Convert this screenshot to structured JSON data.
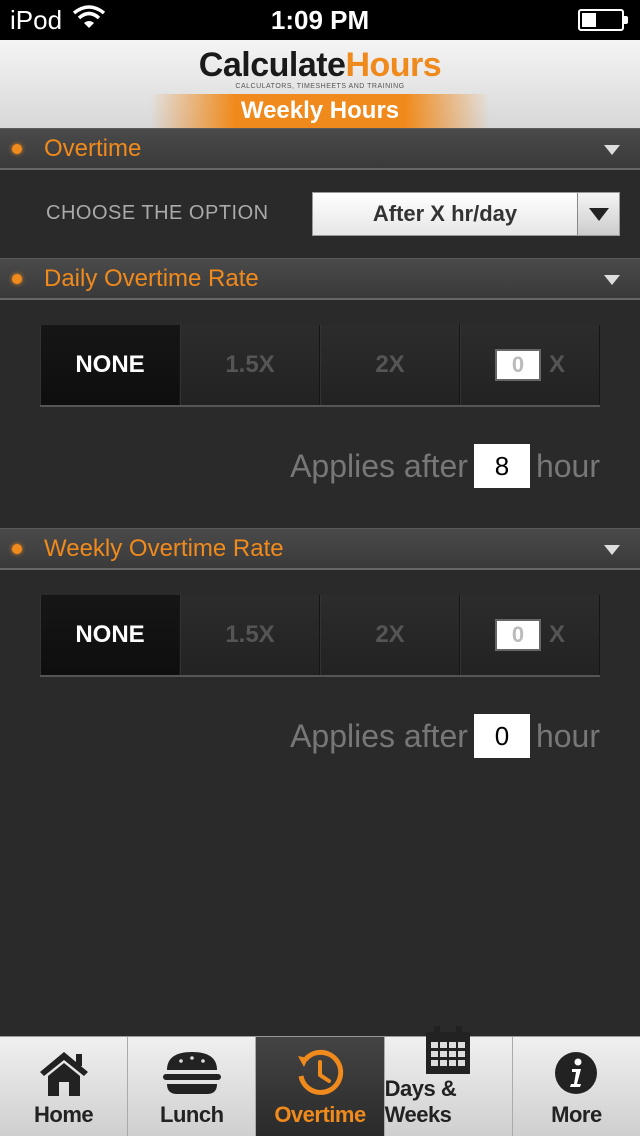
{
  "status_bar": {
    "carrier": "iPod",
    "time": "1:09 PM"
  },
  "header": {
    "logo_part1": "Calculate",
    "logo_part2": "Hours",
    "logo_tagline": "CALCULATORS, TIMESHEETS AND TRAINING",
    "subtitle": "Weekly Hours"
  },
  "overtime": {
    "title": "Overtime",
    "option_label": "CHOOSE THE OPTION",
    "option_value": "After X hr/day"
  },
  "daily": {
    "title": "Daily Overtime Rate",
    "options": [
      "NONE",
      "1.5X",
      "2X"
    ],
    "custom_value": "0",
    "custom_suffix": "X",
    "applies_label": "Applies after",
    "applies_value": "8",
    "applies_unit": "hour"
  },
  "weekly": {
    "title": "Weekly Overtime Rate",
    "options": [
      "NONE",
      "1.5X",
      "2X"
    ],
    "custom_value": "0",
    "custom_suffix": "X",
    "applies_label": "Applies after",
    "applies_value": "0",
    "applies_unit": "hour"
  },
  "tabs": [
    {
      "label": "Home",
      "icon": "home-icon"
    },
    {
      "label": "Lunch",
      "icon": "burger-icon"
    },
    {
      "label": "Overtime",
      "icon": "clock-icon"
    },
    {
      "label": "Days & Weeks",
      "icon": "calendar-icon"
    },
    {
      "label": "More",
      "icon": "info-icon"
    }
  ],
  "colors": {
    "accent": "#f08a1c",
    "background": "#2a2a2a"
  }
}
